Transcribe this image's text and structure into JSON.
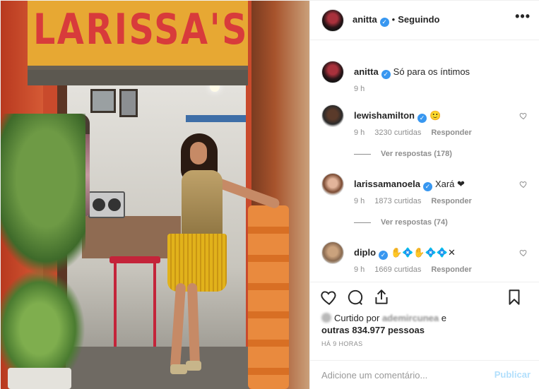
{
  "photo": {
    "sign_text": "LARISSA'S"
  },
  "header": {
    "username": "anitta",
    "separator": "•",
    "follow_status": "Seguindo",
    "more_label": "•••"
  },
  "caption": {
    "username": "anitta",
    "text": "Só para os íntimos",
    "time": "9 h"
  },
  "comments": [
    {
      "username": "lewishamilton",
      "text": "🙂",
      "time": "9 h",
      "likes": "3230 curtidas",
      "reply": "Responder",
      "view_replies": "Ver respostas (178)"
    },
    {
      "username": "larissamanoela",
      "text": "Xará ❤",
      "time": "9 h",
      "likes": "1873 curtidas",
      "reply": "Responder",
      "view_replies": "Ver respostas (74)"
    },
    {
      "username": "diplo",
      "text": "✋💠✋💠💠✕",
      "time": "9 h",
      "likes": "1669 curtidas",
      "reply": "Responder"
    }
  ],
  "likes": {
    "prefix": "Curtido por",
    "liker": "ademircunea",
    "and": "e",
    "others": "outras 834.977 pessoas"
  },
  "posted_time": "HÁ 9 HORAS",
  "add_comment": {
    "placeholder": "Adicione um comentário...",
    "publish_label": "Publicar"
  },
  "colors": {
    "verified": "#3897f0",
    "publish_disabled": "#b2dffc",
    "text_secondary": "#8e8e8e"
  },
  "icons": [
    "heart-icon",
    "comment-icon",
    "share-icon",
    "bookmark-icon",
    "verified-icon",
    "more-icon"
  ]
}
